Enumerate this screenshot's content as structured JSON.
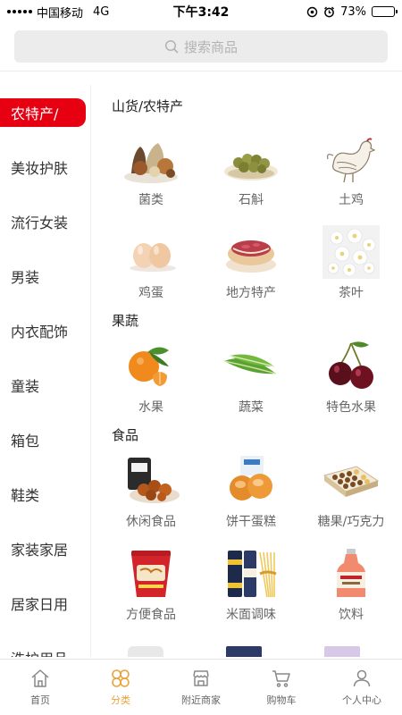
{
  "status_bar": {
    "carrier": "中国移动",
    "network": "4G",
    "time": "下午3:42",
    "battery": "73%",
    "battery_level": 0.73
  },
  "search": {
    "placeholder": "搜索商品"
  },
  "sidebar": {
    "items": [
      {
        "label": "农特产/"
      },
      {
        "label": "美妆护肤"
      },
      {
        "label": "流行女装"
      },
      {
        "label": "男装"
      },
      {
        "label": "内衣配饰"
      },
      {
        "label": "童装"
      },
      {
        "label": "箱包"
      },
      {
        "label": "鞋类"
      },
      {
        "label": "家装家居"
      },
      {
        "label": "居家日用"
      },
      {
        "label": "洗护用品"
      }
    ]
  },
  "sections": [
    {
      "title": "山货/农特产",
      "items": [
        {
          "label": "菌类",
          "icon": "mushroom-icon"
        },
        {
          "label": "石斛",
          "icon": "dendrobium-icon"
        },
        {
          "label": "土鸡",
          "icon": "chicken-icon"
        },
        {
          "label": "鸡蛋",
          "icon": "egg-icon"
        },
        {
          "label": "地方特产",
          "icon": "pastry-icon"
        },
        {
          "label": "茶叶",
          "icon": "tea-flower-icon"
        }
      ]
    },
    {
      "title": "果蔬",
      "items": [
        {
          "label": "水果",
          "icon": "orange-icon"
        },
        {
          "label": "蔬菜",
          "icon": "vegetable-icon"
        },
        {
          "label": "特色水果",
          "icon": "cherry-icon"
        }
      ]
    },
    {
      "title": "食品",
      "items": [
        {
          "label": "休闲食品",
          "icon": "snack-icon"
        },
        {
          "label": "饼干蛋糕",
          "icon": "bread-icon"
        },
        {
          "label": "糖果/巧克力",
          "icon": "chocolate-box-icon"
        },
        {
          "label": "方便食品",
          "icon": "instant-noodle-icon"
        },
        {
          "label": "米面调味",
          "icon": "pasta-icon"
        },
        {
          "label": "饮料",
          "icon": "drink-bottle-icon"
        }
      ]
    }
  ],
  "tabbar": {
    "tabs": [
      {
        "label": "首页",
        "icon": "home-icon"
      },
      {
        "label": "分类",
        "icon": "category-icon",
        "active": true
      },
      {
        "label": "附近商家",
        "icon": "shop-icon"
      },
      {
        "label": "购物车",
        "icon": "cart-icon"
      },
      {
        "label": "个人中心",
        "icon": "user-icon"
      }
    ]
  },
  "colors": {
    "accent": "#e60012",
    "tab_active": "#e8a23a"
  }
}
